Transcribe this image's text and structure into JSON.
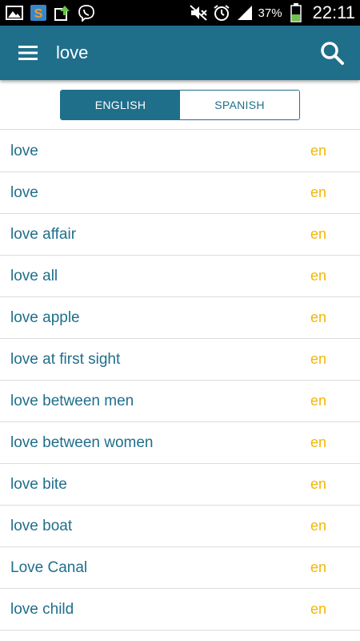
{
  "status_bar": {
    "battery": "37%",
    "time": "22:11",
    "icons": [
      "gallery-icon",
      "app-s-icon",
      "upload-icon",
      "viber-icon",
      "mute-icon",
      "alarm-icon",
      "signal-icon",
      "battery-icon"
    ]
  },
  "app_bar": {
    "title": "love",
    "menu_icon": "hamburger-menu-icon",
    "search_icon": "search-icon"
  },
  "language_tabs": [
    {
      "label": "ENGLISH",
      "selected": true
    },
    {
      "label": "SPANISH",
      "selected": false
    }
  ],
  "results": [
    {
      "term": "love",
      "lang": "en"
    },
    {
      "term": "love",
      "lang": "en"
    },
    {
      "term": "love affair",
      "lang": "en"
    },
    {
      "term": "love all",
      "lang": "en"
    },
    {
      "term": "love apple",
      "lang": "en"
    },
    {
      "term": "love at first sight",
      "lang": "en"
    },
    {
      "term": "love between men",
      "lang": "en"
    },
    {
      "term": "love between women",
      "lang": "en"
    },
    {
      "term": "love bite",
      "lang": "en"
    },
    {
      "term": "love boat",
      "lang": "en"
    },
    {
      "term": "Love Canal",
      "lang": "en"
    },
    {
      "term": "love child",
      "lang": "en"
    }
  ],
  "colors": {
    "primary": "#1f6f8b",
    "lang_accent": "#f2b705",
    "divider": "#dcdcdc"
  }
}
